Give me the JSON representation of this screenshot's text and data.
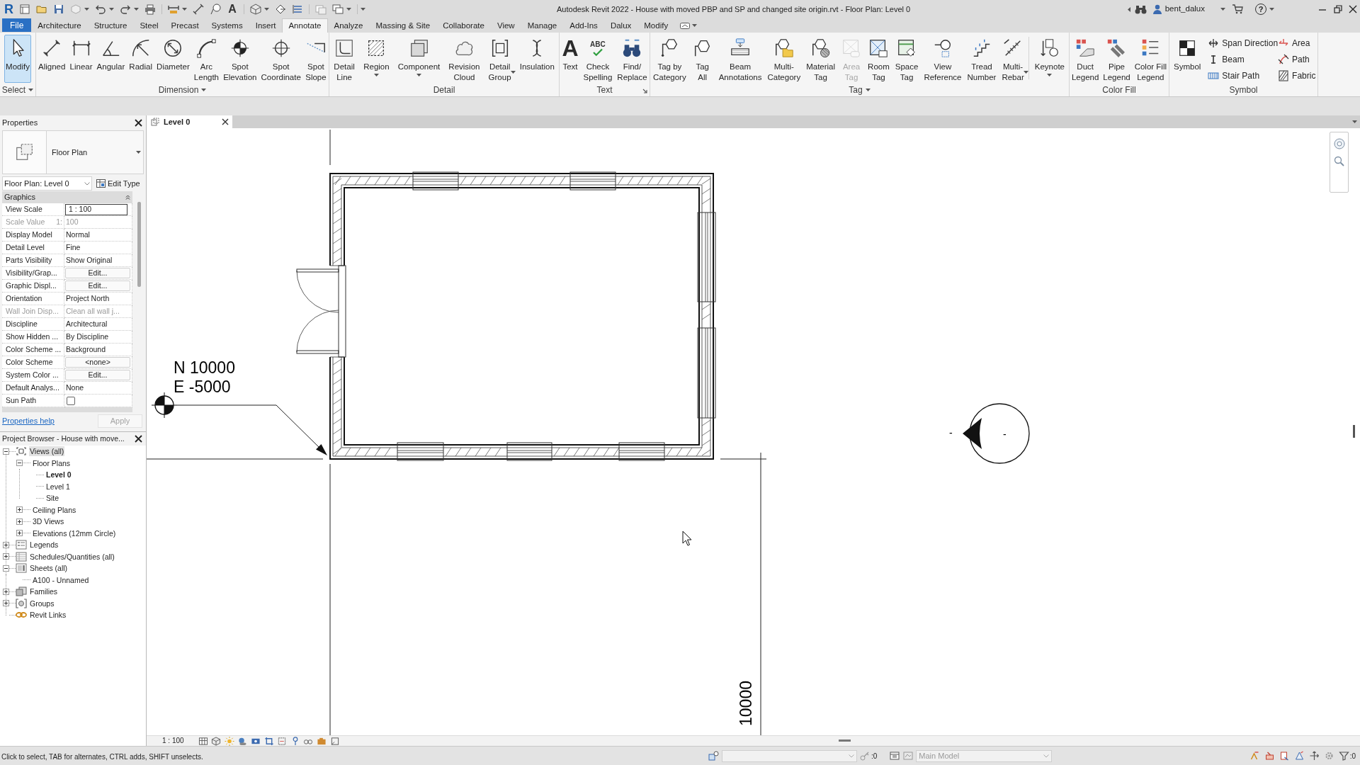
{
  "title_bar": {
    "logo": "R",
    "quick_access_glyph": "A",
    "title": "Autodesk Revit 2022 - House with moved PBP and SP and changed site origin.rvt - Floor Plan: Level 0",
    "user": "bent_dalux",
    "help_glyph": "?"
  },
  "ribbon": {
    "file_button": "File",
    "tabs": [
      {
        "label": "Architecture",
        "selected": false
      },
      {
        "label": "Structure",
        "selected": false
      },
      {
        "label": "Steel",
        "selected": false
      },
      {
        "label": "Precast",
        "selected": false
      },
      {
        "label": "Systems",
        "selected": false
      },
      {
        "label": "Insert",
        "selected": false
      },
      {
        "label": "Annotate",
        "selected": true
      },
      {
        "label": "Analyze",
        "selected": false
      },
      {
        "label": "Massing & Site",
        "selected": false
      },
      {
        "label": "Collaborate",
        "selected": false
      },
      {
        "label": "View",
        "selected": false
      },
      {
        "label": "Manage",
        "selected": false
      },
      {
        "label": "Add-Ins",
        "selected": false
      },
      {
        "label": "Dalux",
        "selected": false
      },
      {
        "label": "Modify",
        "selected": false
      }
    ],
    "panels": [
      {
        "label": "Select",
        "menu": true,
        "launcher": false,
        "groups": [
          [
            {
              "label": "Modify",
              "pressed": true
            }
          ]
        ]
      },
      {
        "label": "Dimension",
        "menu": true,
        "launcher": false,
        "groups": [
          [
            {
              "label": "Aligned"
            },
            {
              "label": "Linear"
            },
            {
              "label": "Angular"
            },
            {
              "label": "Radial"
            },
            {
              "label": "Diameter"
            },
            {
              "label": "Arc\nLength"
            },
            {
              "label": "Spot\nElevation"
            },
            {
              "label": "Spot\nCoordinate"
            },
            {
              "label": "Spot\nSlope"
            }
          ]
        ]
      },
      {
        "label": "Detail",
        "menu": false,
        "launcher": false,
        "groups": [
          [
            {
              "label": "Detail\nLine"
            },
            {
              "label": "Region",
              "dropdown": true
            },
            {
              "label": "Component",
              "dropdown": true
            },
            {
              "label": "Revision\nCloud"
            },
            {
              "label": "Detail\nGroup",
              "dropdown": true
            },
            {
              "label": "Insulation"
            }
          ]
        ]
      },
      {
        "label": "Text",
        "menu": false,
        "launcher": true,
        "groups": [
          [
            {
              "label": "Text",
              "glyph": "A"
            },
            {
              "label": "Check\nSpelling",
              "glyph": "ABC"
            },
            {
              "label": "Find/\nReplace"
            }
          ]
        ]
      },
      {
        "label": "Tag",
        "menu": true,
        "launcher": false,
        "groups": [
          [
            {
              "label": "Tag by\nCategory",
              "disabled": false
            },
            {
              "label": "Tag\nAll",
              "disabled": false
            },
            {
              "label": "Beam\nAnnotations",
              "disabled": false
            },
            {
              "label": "Multi-\nCategory",
              "disabled": false
            },
            {
              "label": "Material\nTag",
              "disabled": false
            },
            {
              "label": "Area\nTag",
              "disabled": true
            },
            {
              "label": "Room\nTag",
              "disabled": false
            },
            {
              "label": "Space\nTag",
              "disabled": false
            },
            {
              "label": "View\nReference",
              "disabled": false
            },
            {
              "label": "Tread\nNumber",
              "disabled": false
            },
            {
              "label": "Multi-\nRebar",
              "dropdown": true,
              "disabled": false
            }
          ],
          [
            {
              "label": "Keynote",
              "dropdown": true,
              "disabled": false
            }
          ]
        ]
      },
      {
        "label": "Color Fill",
        "menu": false,
        "launcher": false,
        "groups": [
          [
            {
              "label": "Duct\nLegend"
            },
            {
              "label": "Pipe\nLegend"
            },
            {
              "label": "Color Fill\nLegend"
            }
          ]
        ]
      },
      {
        "label": "Symbol",
        "menu": false,
        "launcher": false,
        "groups": [
          [
            {
              "label": "Symbol"
            }
          ]
        ],
        "small_columns": [
          [
            "Span Direction",
            "Beam",
            "Stair Path"
          ],
          [
            "Area",
            "Path",
            "Fabric"
          ]
        ]
      }
    ]
  },
  "properties": {
    "title": "Properties",
    "type_name": "Floor Plan",
    "instance": "Floor Plan: Level 0",
    "edit_type": "Edit Type",
    "group": "Graphics",
    "rows": [
      {
        "label": "View Scale",
        "value": "1 : 100",
        "kind": "field",
        "disabled": false
      },
      {
        "label": "Scale Value",
        "prefix": "1:",
        "value": "100",
        "kind": "text",
        "disabled": true
      },
      {
        "label": "Display Model",
        "value": "Normal",
        "kind": "text",
        "disabled": false
      },
      {
        "label": "Detail Level",
        "value": "Fine",
        "kind": "text",
        "disabled": false
      },
      {
        "label": "Parts Visibility",
        "value": "Show Original",
        "kind": "text",
        "disabled": false
      },
      {
        "label": "Visibility/Grap...",
        "value": "Edit...",
        "kind": "button",
        "disabled": false
      },
      {
        "label": "Graphic Displ...",
        "value": "Edit...",
        "kind": "button",
        "disabled": false
      },
      {
        "label": "Orientation",
        "value": "Project North",
        "kind": "text",
        "disabled": false
      },
      {
        "label": "Wall Join Disp...",
        "value": "Clean all wall j...",
        "kind": "text",
        "disabled": true
      },
      {
        "label": "Discipline",
        "value": "Architectural",
        "kind": "text",
        "disabled": false
      },
      {
        "label": "Show Hidden ...",
        "value": "By Discipline",
        "kind": "text",
        "disabled": false
      },
      {
        "label": "Color Scheme ...",
        "value": "Background",
        "kind": "text",
        "disabled": false
      },
      {
        "label": "Color Scheme",
        "value": "<none>",
        "kind": "button",
        "disabled": false
      },
      {
        "label": "System Color ...",
        "value": "Edit...",
        "kind": "button",
        "disabled": false
      },
      {
        "label": "Default Analys...",
        "value": "None",
        "kind": "text",
        "disabled": false
      },
      {
        "label": "Sun Path",
        "kind": "checkbox",
        "checked": false,
        "disabled": false
      }
    ],
    "help_link": "Properties help",
    "apply": "Apply",
    "apply_disabled": true
  },
  "project_browser": {
    "title": "Project Browser - House with move...",
    "tree": [
      {
        "label": "Views (all)",
        "kind": "views",
        "expanded": true,
        "selected": true,
        "current": false,
        "children": [
          {
            "label": "Floor Plans",
            "expanded": true,
            "selected": false,
            "current": false,
            "children": [
              {
                "label": "Level 0",
                "selected": false,
                "current": true
              },
              {
                "label": "Level 1",
                "selected": false,
                "current": false
              },
              {
                "label": "Site",
                "selected": false,
                "current": false
              }
            ]
          },
          {
            "label": "Ceiling Plans",
            "expanded": false,
            "selected": false,
            "current": false
          },
          {
            "label": "3D Views",
            "expanded": false,
            "selected": false,
            "current": false
          },
          {
            "label": "Elevations (12mm Circle)",
            "expanded": false,
            "selected": false,
            "current": false
          }
        ]
      },
      {
        "label": "Legends",
        "kind": "legends",
        "expanded": false,
        "selected": false,
        "current": false
      },
      {
        "label": "Schedules/Quantities (all)",
        "kind": "schedules",
        "expanded": false,
        "selected": false,
        "current": false
      },
      {
        "label": "Sheets (all)",
        "kind": "sheets",
        "expanded": true,
        "selected": false,
        "current": false,
        "children": [
          {
            "label": "A100 - Unnamed",
            "selected": false,
            "current": false
          }
        ]
      },
      {
        "label": "Families",
        "kind": "families",
        "expanded": false,
        "selected": false,
        "current": false
      },
      {
        "label": "Groups",
        "kind": "groups",
        "expanded": false,
        "selected": false,
        "current": false
      },
      {
        "label": "Revit Links",
        "kind": "links",
        "selected": false,
        "current": false
      }
    ]
  },
  "view_tabs": [
    {
      "label": "Level 0",
      "selected": true
    }
  ],
  "canvas": {
    "survey_point": {
      "north": "N 10000",
      "east": "E -5000"
    },
    "elevation_marker": {
      "left": "-",
      "right": "-"
    },
    "dimension": "10000"
  },
  "view_control_bar": {
    "scale": "1 : 100"
  },
  "status_bar": {
    "message": "Click to select, TAB for alternates, CTRL adds, SHIFT unselects.",
    "key_count": ":0",
    "model": "Main Model",
    "filter_count": ":0"
  }
}
